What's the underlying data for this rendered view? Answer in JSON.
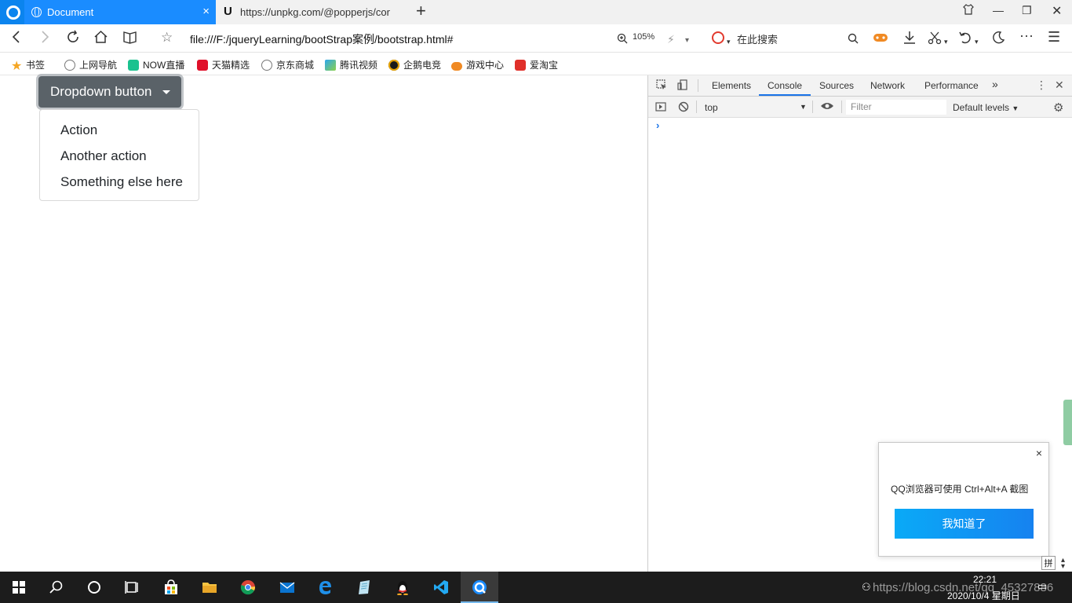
{
  "tabs": [
    {
      "title": "Document",
      "active": true
    },
    {
      "title": "https://unpkg.com/@popperjs/cor"
    }
  ],
  "navbar": {
    "address": "file:///F:/jqueryLearning/bootStrap案例/bootstrap.html#",
    "zoom": "105%",
    "search_placeholder": "在此搜索"
  },
  "bookmarks": [
    {
      "label": "书签",
      "icon": "star-icon",
      "color": "#f5a623"
    },
    {
      "label": "上网导航",
      "icon": "globe-icon",
      "color": "#888888"
    },
    {
      "label": "NOW直播",
      "icon": "now-icon",
      "color": "#1bc28f"
    },
    {
      "label": "天猫精选",
      "icon": "tmall-icon",
      "color": "#e0102a"
    },
    {
      "label": "京东商城",
      "icon": "globe-icon",
      "color": "#888888"
    },
    {
      "label": "腾讯视频",
      "icon": "play-icon",
      "color": "#2da7f0"
    },
    {
      "label": "企鹅电竞",
      "icon": "penguin-icon",
      "color": "#e8a400"
    },
    {
      "label": "游戏中心",
      "icon": "gamepad-icon",
      "color": "#f08a24"
    },
    {
      "label": "爱淘宝",
      "icon": "taobao-icon",
      "color": "#e0302a"
    }
  ],
  "page": {
    "dropdown_label": "Dropdown button",
    "menu_items": [
      "Action",
      "Another action",
      "Something else here"
    ]
  },
  "devtools": {
    "tabs": [
      "Elements",
      "Console",
      "Sources",
      "Network",
      "Performance"
    ],
    "active_tab": "Console",
    "more": "»",
    "context": "top",
    "filter_placeholder": "Filter",
    "levels": "Default levels",
    "prompt": "›"
  },
  "popup": {
    "message": "QQ浏览器可使用 Ctrl+Alt+A 截图",
    "ok_label": "我知道了",
    "close": "×"
  },
  "taskbar": {
    "time": "22:21",
    "date": "2020/10/4 星期日",
    "watermark": "https://blog.csdn.net/qq_45327886",
    "ime": "拼"
  }
}
